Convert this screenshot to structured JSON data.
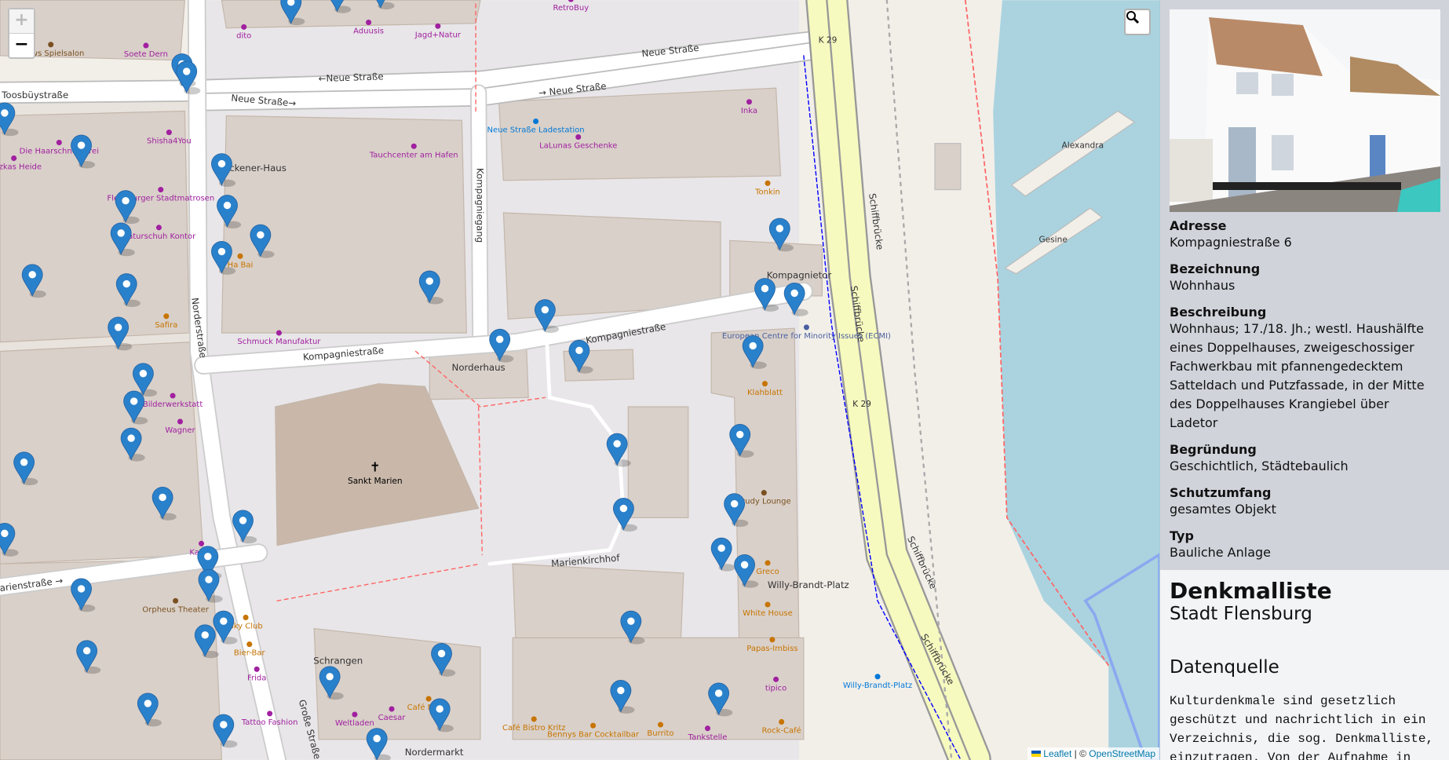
{
  "map": {
    "zoom_in": "+",
    "zoom_out": "−",
    "search_icon": "magnifier-icon",
    "attribution": {
      "leaflet": "Leaflet",
      "sep": " | © ",
      "osm": "OpenStreetMap"
    },
    "streets": [
      "Neue Straße",
      "←Neue Straße",
      "Neue Straße→",
      "→ Neue Straße",
      "Toosbüystraße",
      "Kompagniegang",
      "Kompagniestraße",
      "Kompagniestraße",
      "Norderstraße",
      "Marienkirchhof",
      "Marienstraße →",
      "Große Straße",
      "Schiffbrücke",
      "Schiffbrücke",
      "Schiffbrücke",
      "Schiffbrücke",
      "K 29",
      "K 29"
    ],
    "places": [
      "Sankt Marien",
      "Norderhaus",
      "Eckener-Haus",
      "Kompagnietor",
      "Willy-Brandt-Platz",
      "Nordermarkt",
      "Schrangen",
      "Alexandra",
      "Gesine"
    ],
    "pois": [
      "Drews Spielsalon",
      "Soete Dern",
      "dito",
      "Aduusis",
      "Jagd+Natur",
      "RetroBuy",
      "Shisha4You",
      "Die Haarschneiderei",
      "Witzkas Heide",
      "Flensburger Stadtmatrosen",
      "Naturschuh Kontor",
      "Tauchcenter am Hafen",
      "Neue Straße Ladestation",
      "LaLunas Geschenke",
      "Inka",
      "Tonkin",
      "Schmuck Manufaktur",
      "Safira",
      "Bilderwerkstatt",
      "Wagner",
      "Kabus",
      "Orpheus Theater",
      "European Centre for Minority Issues (ECMI)",
      "Klahblatt",
      "Study Lounge",
      "Greco",
      "White House",
      "Papas-Imbiss",
      "tipico",
      "Bier-Bar",
      "Frida",
      "Tattoo Fashion",
      "Weltladen",
      "Caesar",
      "Café Mette",
      "Café Bistro Kritz",
      "Bennys Bar Cocktailbar",
      "Burrito",
      "Tankstelle",
      "Rock-Café",
      "Willy-Brandt-Platz",
      "Sky Club",
      "Ha Bai"
    ]
  },
  "detail": {
    "photo_alt": "Kompagniestraße 6 Wohnhaus",
    "fields": [
      {
        "label": "Adresse",
        "value": "Kompagniestraße 6"
      },
      {
        "label": "Bezeichnung",
        "value": "Wohnhaus"
      },
      {
        "label": "Beschreibung",
        "value": "Wohnhaus; 17./18. Jh.; westl. Haushälfte eines Doppelhauses, zweigeschossiger Fachwerkbau mit pfannengedecktem Satteldach und Putzfassade, in der Mitte des Doppelhauses Krangiebel über Ladetor"
      },
      {
        "label": "Begründung",
        "value": "Geschichtlich, Städtebaulich"
      },
      {
        "label": "Schutzumfang",
        "value": "gesamtes Objekt"
      },
      {
        "label": "Typ",
        "value": "Bauliche Anlage"
      }
    ]
  },
  "info": {
    "title": "Denkmalliste",
    "subtitle": "Stadt Flensburg",
    "section": "Datenquelle",
    "text": "Kulturdenkmale sind gesetzlich geschützt und nachrichtlich in ein Verzeichnis, die sog. Denkmalliste, einzutragen. Von der Aufnahme in"
  },
  "colors": {
    "marker": "#2a81cb",
    "water": "#aad3df",
    "building": "#d9d0c9",
    "trunk": "#f7fabf",
    "panel": "#d0d3da"
  }
}
